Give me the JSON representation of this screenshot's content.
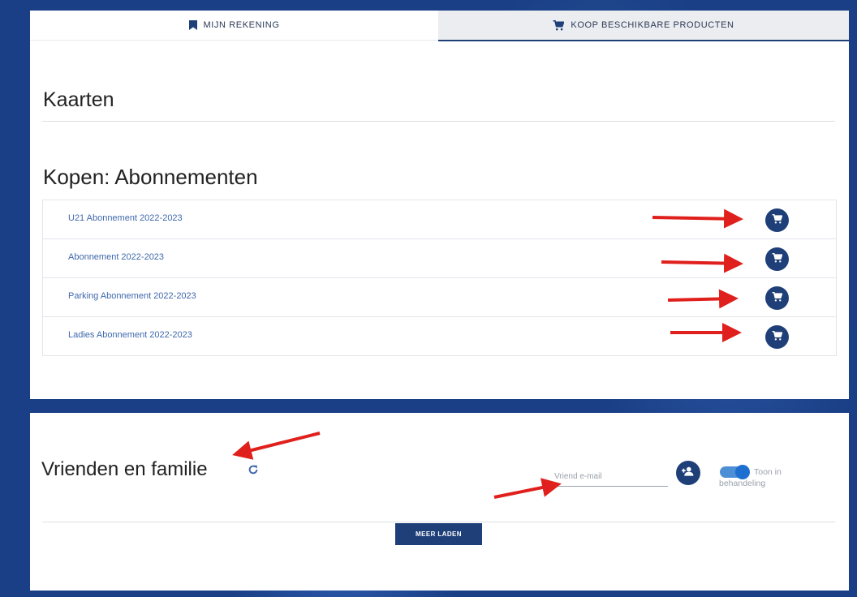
{
  "tabs": [
    {
      "label": "MIJN REKENING",
      "icon": "bookmark-icon",
      "active": false
    },
    {
      "label": "KOOP BESCHIKBARE PRODUCTEN",
      "icon": "cart-icon",
      "active": true
    }
  ],
  "kaarten": {
    "title": "Kaarten"
  },
  "kopen": {
    "title": "Kopen: Abonnementen",
    "items": [
      {
        "label": "U21 Abonnement 2022-2023",
        "action_icon": "cart-icon"
      },
      {
        "label": "Abonnement 2022-2023",
        "action_icon": "cart-icon"
      },
      {
        "label": "Parking Abonnement 2022-2023",
        "action_icon": "cart-icon"
      },
      {
        "label": "Ladies Abonnement 2022-2023",
        "action_icon": "cart-icon"
      }
    ]
  },
  "vrienden": {
    "title": "Vrienden en familie",
    "email_placeholder": "Vriend e-mail",
    "email_value": "",
    "toggle_label": "Toon in behandeling",
    "toggle_on": true,
    "load_more_label": "MEER LADEN"
  },
  "colors": {
    "primary": "#1f3f78",
    "link": "#3f68ad",
    "annotation_arrow": "#e0201c",
    "background": "#1a3f86"
  }
}
